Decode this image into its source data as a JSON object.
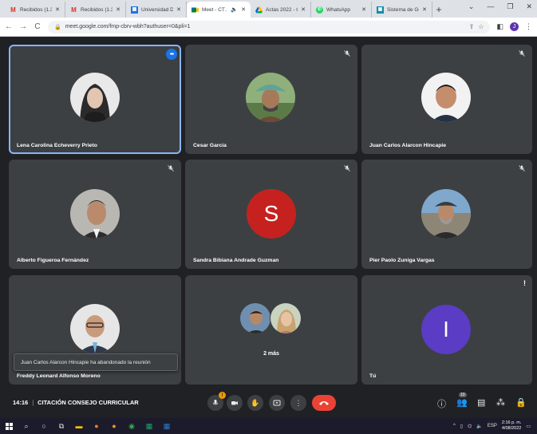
{
  "browser": {
    "tabs": [
      {
        "title": "Recibidos (1.3…",
        "icon": "gmail-icon",
        "active": false
      },
      {
        "title": "Recibidos (1.3…",
        "icon": "gmail-icon",
        "active": false
      },
      {
        "title": "Universidad D…",
        "icon": "university-icon",
        "active": false
      },
      {
        "title": "Meet - CT…",
        "icon": "meet-icon",
        "active": true
      },
      {
        "title": "Actas 2022 - G…",
        "icon": "drive-icon",
        "active": false
      },
      {
        "title": "WhatsApp",
        "icon": "whatsapp-icon",
        "active": false
      },
      {
        "title": "Sistema de Ge…",
        "icon": "system-icon",
        "active": false
      }
    ],
    "new_tab": "+",
    "url": "meet.google.com/fmp-cbrv-wbh?authuser=0&pli=1",
    "profile_initial": "J"
  },
  "participants": [
    {
      "name": "Lena Carolina Echeverry Prieto",
      "speaking": true
    },
    {
      "name": "Cesar Garcia"
    },
    {
      "name": "Juan Carlos Alarcon Hincapie"
    },
    {
      "name": "Alberto Figueroa Fernández"
    },
    {
      "name": "Sandra Bibiana Andrade Guzman",
      "initial": "S",
      "color": "#c5221f"
    },
    {
      "name": "Pier Paolo Zuniga Vargas"
    },
    {
      "name": "Freddy Leonard Alfonso Moreno"
    },
    {
      "more_label": "2 más"
    },
    {
      "name": "Tú",
      "initial": "I",
      "color": "#5b3cc4"
    }
  ],
  "toast": "Juan Carlos Alarcon Hincapie ha abandonado la reunión",
  "meeting": {
    "time": "14:16",
    "title": "CITACIÓN CONSEJO CURRICULAR",
    "people_count": "10",
    "mic_badge": "!"
  },
  "taskbar": {
    "language": "ESP",
    "time": "2:16 p. m.",
    "date": "4/08/2022"
  }
}
